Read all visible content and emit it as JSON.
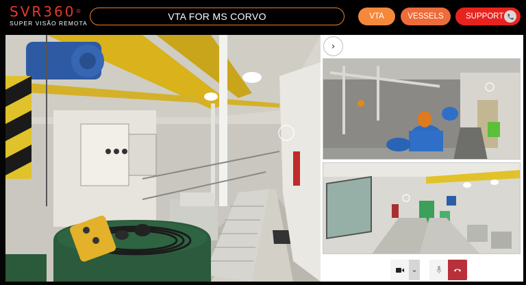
{
  "header": {
    "logo_text": "SVR360",
    "logo_reg": "®",
    "logo_subtitle": "SUPER VISÃO REMOTA",
    "title": "VTA FOR MS CORVO",
    "nav": {
      "vta_label": "VTA",
      "vessels_label": "VESSELS",
      "support_label": "SUPPORT"
    }
  },
  "colors": {
    "brand_red": "#e8392e",
    "vta_button": "#f5883a",
    "vessels_button": "#ee6b3a",
    "support_button": "#e8231f",
    "title_border": "#f07f2a",
    "hangup": "#b8303a"
  },
  "main_view": {
    "label": "360 panoramic view of engine room corridor"
  },
  "right_panel": {
    "toggle_icon": "chevron-right-icon",
    "toggle_glyph": "›",
    "thumbnails": [
      {
        "label": "engine room machinery"
      },
      {
        "label": "engine room corridor"
      }
    ],
    "controls": [
      {
        "icon": "video-camera-icon"
      },
      {
        "icon": "chevron-down-icon",
        "glyph": "⌄"
      },
      {
        "icon": "microphone-icon"
      },
      {
        "icon": "hangup-phone-icon"
      }
    ]
  }
}
